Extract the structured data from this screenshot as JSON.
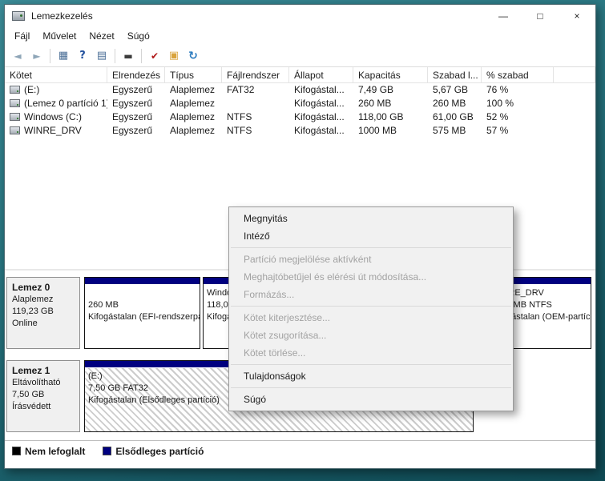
{
  "window": {
    "title": "Lemezkezelés"
  },
  "icons": {
    "back": "◄",
    "forward": "►",
    "console_tree": "▦",
    "help": "?",
    "list_view": "▤",
    "action_pane": "▬",
    "check_doc": "✔",
    "folder": "▣",
    "refresh": "↻",
    "minimize": "—",
    "maximize": "□",
    "close": "×"
  },
  "menubar": {
    "items": [
      "Fájl",
      "Művelet",
      "Nézet",
      "Súgó"
    ]
  },
  "volume_table": {
    "columns": [
      "Kötet",
      "Elrendezés",
      "Típus",
      "Fájlrendszer",
      "Állapot",
      "Kapacitás",
      "Szabad l...",
      "% szabad"
    ],
    "rows": [
      {
        "volume": "(E:)",
        "layout": "Egyszerű",
        "type": "Alaplemez",
        "fs": "FAT32",
        "status": "Kifogástal...",
        "capacity": "7,49 GB",
        "free": "5,67 GB",
        "pct": "76 %"
      },
      {
        "volume": "(Lemez 0 partíció 1)",
        "layout": "Egyszerű",
        "type": "Alaplemez",
        "fs": "",
        "status": "Kifogástal...",
        "capacity": "260 MB",
        "free": "260 MB",
        "pct": "100 %"
      },
      {
        "volume": "Windows (C:)",
        "layout": "Egyszerű",
        "type": "Alaplemez",
        "fs": "NTFS",
        "status": "Kifogástal...",
        "capacity": "118,00 GB",
        "free": "61,00 GB",
        "pct": "52 %"
      },
      {
        "volume": "WINRE_DRV",
        "layout": "Egyszerű",
        "type": "Alaplemez",
        "fs": "NTFS",
        "status": "Kifogástal...",
        "capacity": "1000 MB",
        "free": "575 MB",
        "pct": "57 %"
      }
    ]
  },
  "context_menu": {
    "items": [
      {
        "label": "Megnyitás",
        "enabled": true
      },
      {
        "label": "Intéző",
        "enabled": true
      },
      {
        "label": "Partíció megjelölése aktívként",
        "enabled": false
      },
      {
        "label": "Meghajtóbetűjel és elérési út módosítása...",
        "enabled": false
      },
      {
        "label": "Formázás...",
        "enabled": false
      },
      {
        "label": "Kötet kiterjesztése...",
        "enabled": false
      },
      {
        "label": "Kötet zsugorítása...",
        "enabled": false
      },
      {
        "label": "Kötet törlése...",
        "enabled": false
      },
      {
        "label": "Tulajdonságok",
        "enabled": true
      },
      {
        "label": "Súgó",
        "enabled": true
      }
    ]
  },
  "disks": [
    {
      "name": "Lemez 0",
      "info_lines": [
        "Alaplemez",
        "119,23 GB",
        "Online"
      ],
      "partitions": [
        {
          "name": "",
          "size": "260 MB",
          "status": "Kifogástalan (EFI-rendszerpartíció)"
        },
        {
          "name": "Windows (C:)",
          "size": "118,00 GB NTFS",
          "status": "Kifogástalan"
        },
        {
          "name": "WINRE_DRV",
          "size": "1000 MB NTFS",
          "status": "Kifogástalan (OEM-partíció)"
        }
      ]
    },
    {
      "name": "Lemez 1",
      "info_lines": [
        "Eltávolítható",
        "7,50 GB",
        "Írásvédett"
      ],
      "partitions": [
        {
          "name": "(E:)",
          "size": "7,50 GB FAT32",
          "status": "Kifogástalan (Elsődleges partíció)"
        }
      ]
    }
  ],
  "legend": {
    "items": [
      {
        "label": "Nem lefoglalt",
        "color": "#000000"
      },
      {
        "label": "Elsődleges partíció",
        "color": "#000080"
      }
    ]
  },
  "colors": {
    "primary_partition": "#000080",
    "unallocated": "#000000"
  }
}
